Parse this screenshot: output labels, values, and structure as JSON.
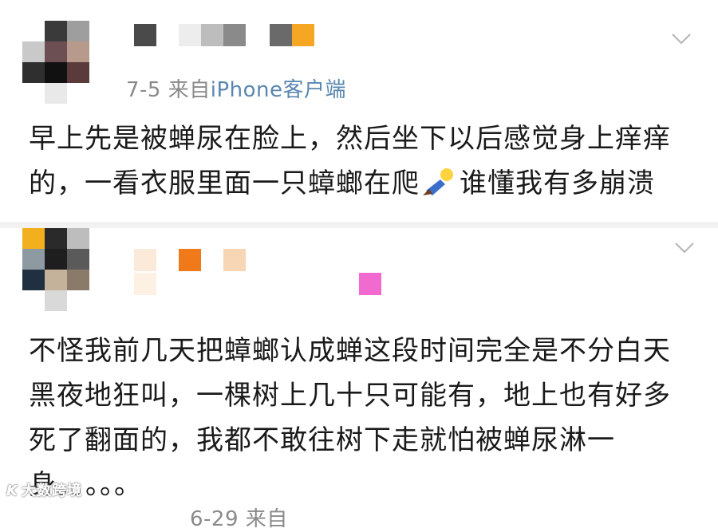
{
  "posts": [
    {
      "date": "7-5",
      "source_prefix": "来自",
      "source_name": "iPhone客户端",
      "text_before_emoji": "早上先是被蝉尿在脸上，然后坐下以后感觉身上痒痒的，一看衣服里面一只蟑螂在爬",
      "emoji": "collapse-emoji",
      "text_after_emoji": "谁懂我有多崩溃"
    },
    {
      "date": "6-29",
      "source_prefix": "来自",
      "source_name": "",
      "text": "不怪我前几天把蟑螂认成蝉这段时间完全是不分白天黑夜地狂叫，一棵树上几十只可能有，地上也有好多死了翻面的，我都不敢往树下走就怕被蝉尿淋一身。。。。。"
    }
  ],
  "icons": {
    "expand": "chevron-down-icon"
  },
  "watermark": {
    "logo": "K",
    "text": "大数跨境"
  }
}
